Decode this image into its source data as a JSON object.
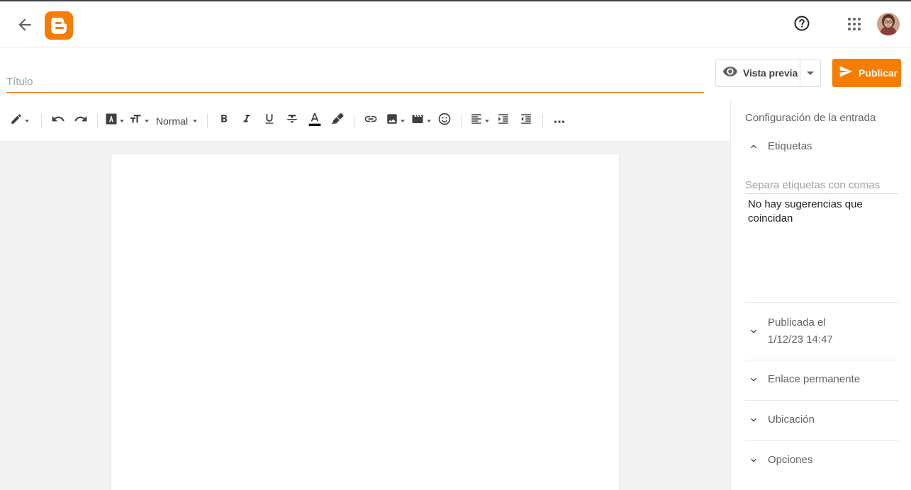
{
  "appbar": {
    "back_icon": "arrow-back-icon",
    "logo_icon": "blogger-logo-icon",
    "help_icon": "help-circle-icon",
    "apps_icon": "apps-grid-icon",
    "avatar_icon": "user-avatar"
  },
  "editor": {
    "title_placeholder": "Título",
    "preview_label": "Vista previa",
    "publish_label": "Publicar",
    "format_label": "Normal"
  },
  "colors": {
    "accent": "#f57d00",
    "title_underline": "#e8710a"
  },
  "sidebar": {
    "title": "Configuración de la entrada",
    "labels_section": "Etiquetas",
    "labels_placeholder": "Separa etiquetas con comas",
    "no_suggestions": "No hay sugerencias que coincidan",
    "published_line1": "Publicada el",
    "published_line2": "1/12/23 14:47",
    "permalink": "Enlace permanente",
    "location": "Ubicación",
    "options": "Opciones"
  }
}
